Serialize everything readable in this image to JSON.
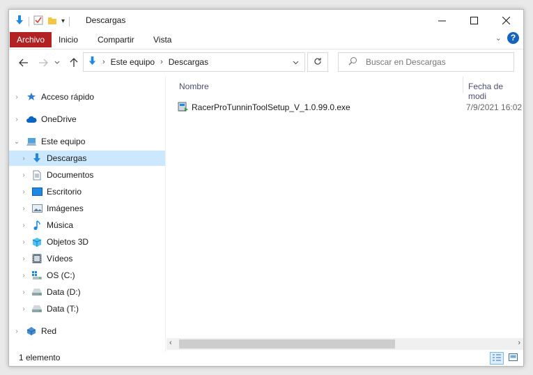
{
  "window": {
    "title": "Descargas"
  },
  "ribbon": {
    "tabs": [
      "Archivo",
      "Inicio",
      "Compartir",
      "Vista"
    ],
    "file_color": "#b22222"
  },
  "address": {
    "crumbs": [
      "Este equipo",
      "Descargas"
    ]
  },
  "search": {
    "placeholder": "Buscar en Descargas"
  },
  "nav": {
    "items": [
      {
        "label": "Acceso rápido",
        "icon": "star-icon"
      },
      {
        "label": "OneDrive",
        "icon": "cloud-icon"
      },
      {
        "label": "Este equipo",
        "icon": "computer-icon"
      },
      {
        "label": "Descargas",
        "icon": "download-icon",
        "selected": true
      },
      {
        "label": "Documentos",
        "icon": "document-icon"
      },
      {
        "label": "Escritorio",
        "icon": "desktop-icon"
      },
      {
        "label": "Imágenes",
        "icon": "picture-icon"
      },
      {
        "label": "Música",
        "icon": "music-icon"
      },
      {
        "label": "Objetos 3D",
        "icon": "cube-icon"
      },
      {
        "label": "Vídeos",
        "icon": "video-icon"
      },
      {
        "label": "OS (C:)",
        "icon": "windows-drive-icon"
      },
      {
        "label": "Data (D:)",
        "icon": "drive-icon"
      },
      {
        "label": "Data (T:)",
        "icon": "drive-icon"
      },
      {
        "label": "Red",
        "icon": "network-icon"
      }
    ]
  },
  "columns": {
    "name": "Nombre",
    "date": "Fecha de modi"
  },
  "files": [
    {
      "name": "RacerProTunninToolSetup_V_1.0.99.0.exe",
      "date": "7/9/2021 16:02",
      "icon": "installer-icon"
    }
  ],
  "status": {
    "count": "1 elemento"
  },
  "colors": {
    "selection": "#cce8ff",
    "accent": "#1565c0"
  }
}
